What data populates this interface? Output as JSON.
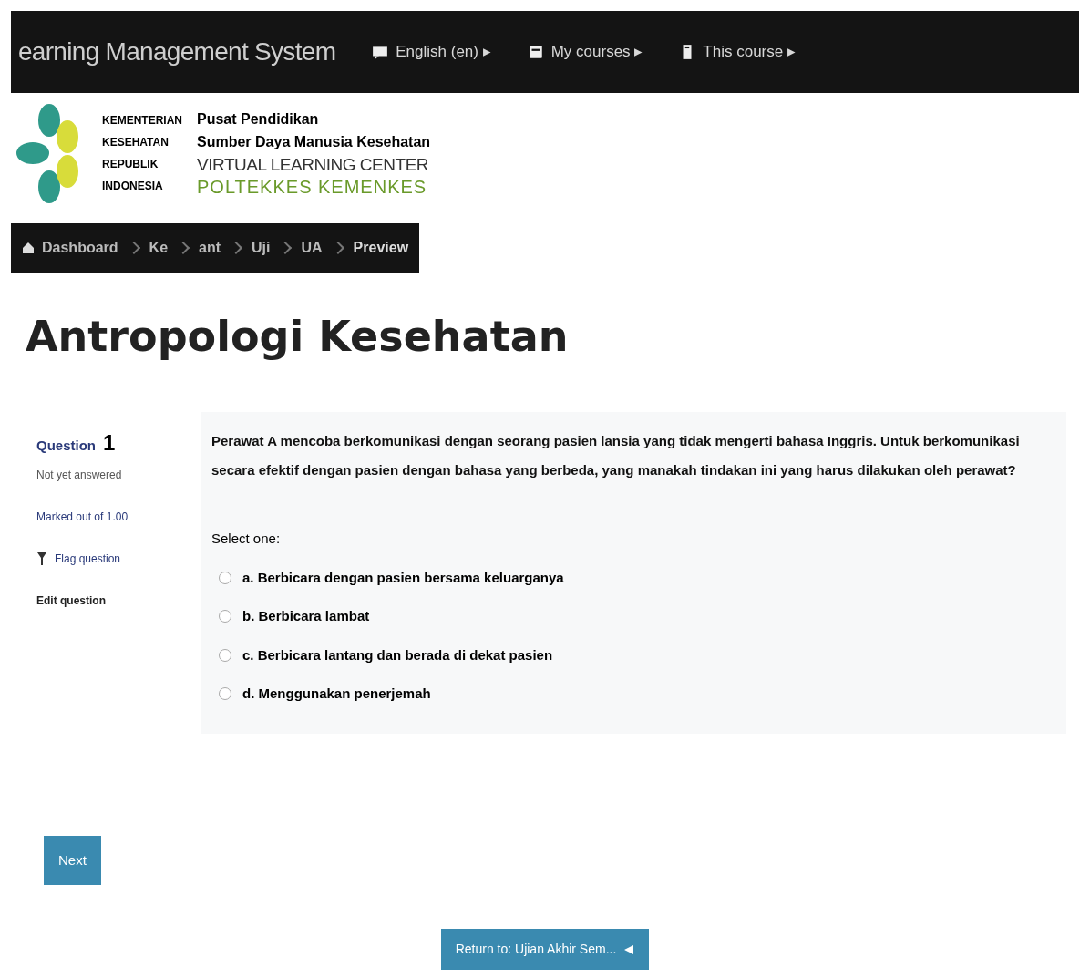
{
  "navbar": {
    "title": "earning Management System",
    "menus": [
      {
        "kind": "language",
        "label": "English (en) ▸"
      },
      {
        "kind": "courses",
        "label": "My courses ▸"
      },
      {
        "kind": "course",
        "label": "This course ▸"
      }
    ]
  },
  "logo": {
    "ministry": [
      "KEMENTERIAN",
      "KESEHATAN",
      "REPUBLIK",
      "INDONESIA"
    ],
    "lines": [
      "Pusat Pendidikan",
      "Sumber Daya Manusia Kesehatan",
      "VIRTUAL LEARNING CENTER",
      "POLTEKKES KEMENKES"
    ]
  },
  "breadcrumb": [
    "Dashboard",
    "Ke",
    "ant",
    "Uji",
    "UA",
    "Preview"
  ],
  "page_title": "Antropologi Kesehatan",
  "question_info": {
    "label": "Question",
    "number": "1",
    "status": "Not yet answered",
    "marks": "Marked out of 1.00",
    "flag": "Flag question",
    "edit": "Edit question"
  },
  "question": {
    "text": "Perawat A mencoba berkomunikasi dengan seorang pasien lansia yang tidak mengerti bahasa Inggris. Untuk berkomunikasi secara efektif dengan pasien dengan bahasa yang berbeda, yang manakah tindakan ini yang harus dilakukan oleh perawat?",
    "prompt": "Select one:",
    "options": [
      {
        "label": "a. Berbicara dengan pasien bersama keluarganya",
        "selected": false
      },
      {
        "label": "b. Berbicara lambat",
        "selected": false
      },
      {
        "label": "c. Berbicara lantang dan berada di dekat pasien",
        "selected": false
      },
      {
        "label": "d. Menggunakan penerjemah",
        "selected": false
      }
    ]
  },
  "next_button": "Next",
  "return_button": "Return to: Ujian Akhir Sem..."
}
